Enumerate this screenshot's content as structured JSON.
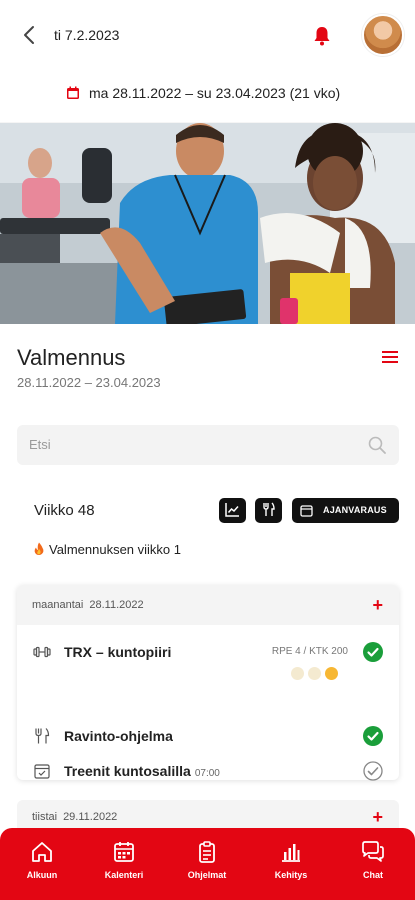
{
  "header": {
    "date": "ti 7.2.2023",
    "period": "ma 28.11.2022 – su 23.04.2023 (21 vko)"
  },
  "coaching": {
    "title": "Valmennus",
    "dates": "28.11.2022 – 23.04.2023"
  },
  "search": {
    "placeholder": "Etsi"
  },
  "week": {
    "label": "Viikko 48",
    "booking_label": "AJANVARAUS",
    "coaching_week": "Valmennuksen viikko 1"
  },
  "days": [
    {
      "weekday": "maanantai",
      "date": "28.11.2022",
      "items": [
        {
          "label": "TRX – kuntopiiri",
          "meta": "RPE 4 / KTK 200",
          "icon": "dumbbell-icon",
          "done": true
        },
        {
          "label": "Ravinto-ohjelma",
          "icon": "cutlery-icon",
          "done": true
        },
        {
          "label": "Treenit kuntosalilla",
          "time": "07:00",
          "icon": "calendar-check-icon",
          "done": false
        }
      ]
    },
    {
      "weekday": "tiistai",
      "date": "29.11.2022"
    }
  ],
  "nav": [
    {
      "label": "Alkuun",
      "icon": "home-icon"
    },
    {
      "label": "Kalenteri",
      "icon": "calendar-icon"
    },
    {
      "label": "Ohjelmat",
      "icon": "clipboard-icon"
    },
    {
      "label": "Kehitys",
      "icon": "bar-chart-icon"
    },
    {
      "label": "Chat",
      "icon": "chat-icon"
    }
  ],
  "colors": {
    "accent": "#e30613",
    "done": "#1a9e3a",
    "dark": "#111111"
  }
}
